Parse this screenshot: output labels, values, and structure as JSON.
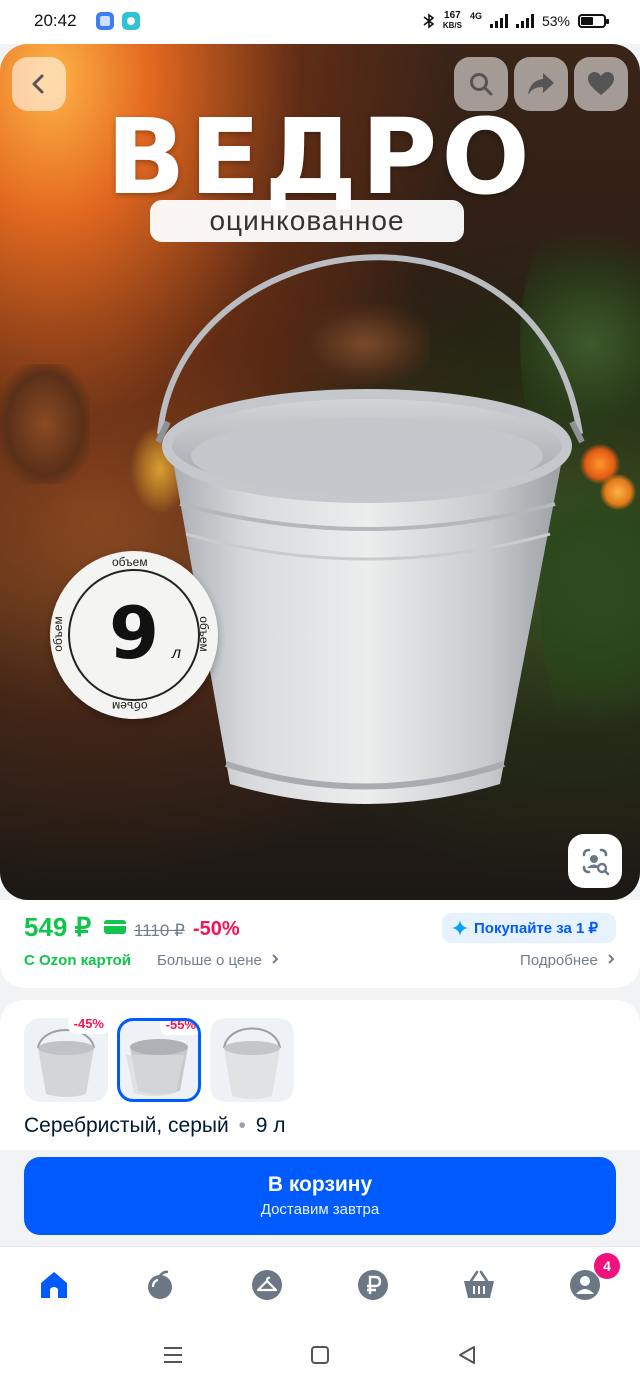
{
  "status_bar": {
    "time": "20:42",
    "net_speed_value": "167",
    "net_speed_unit": "KB/S",
    "network_type": "4G",
    "battery": "53%"
  },
  "product": {
    "hero_title": "ВЕДРО",
    "hero_subtitle": "оцинкованное",
    "volume_badge": {
      "ring_text": "объем",
      "value": "9",
      "unit": "л"
    }
  },
  "price": {
    "current": "549 ₽",
    "old": "1110 ₽",
    "discount": "-50%",
    "ozon_card_label": "С Ozon картой",
    "more_about_price": "Больше о цене",
    "buy_for_1": "Покупайте за 1 ₽",
    "details": "Подробнее"
  },
  "variants": {
    "items": [
      {
        "discount": "-45%",
        "selected": false
      },
      {
        "discount": "-55%",
        "selected": true
      },
      {
        "discount": "",
        "selected": false
      }
    ],
    "color_label": "Серебристый, серый",
    "separator": "•",
    "size_label": "9 л"
  },
  "cart": {
    "title": "В корзину",
    "subtitle": "Доставим завтра"
  },
  "tabbar": {
    "items": [
      {
        "icon": "home-icon",
        "active": true
      },
      {
        "icon": "fresh-icon",
        "active": false
      },
      {
        "icon": "hanger-icon",
        "active": false
      },
      {
        "icon": "ruble-icon",
        "active": false
      },
      {
        "icon": "cart-icon",
        "active": false
      },
      {
        "icon": "profile-icon",
        "active": false
      }
    ],
    "profile_badge": "4"
  },
  "colors": {
    "accent": "#005bff",
    "price_green": "#10c44c",
    "discount_pink": "#f91155",
    "badge_magenta": "#f1117e"
  }
}
